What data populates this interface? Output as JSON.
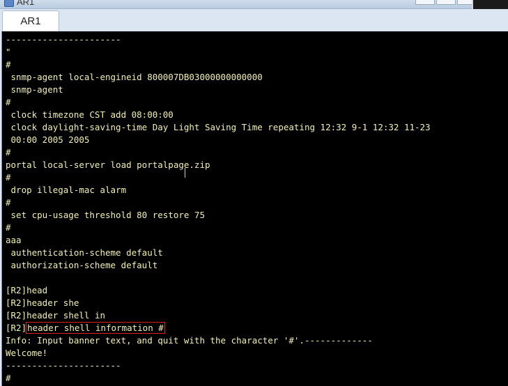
{
  "window": {
    "title": "AR1"
  },
  "tabs": [
    {
      "label": "AR1"
    }
  ],
  "terminal": {
    "lines": [
      {
        "text": "----------------------"
      },
      {
        "text": "\""
      },
      {
        "text": "#"
      },
      {
        "text": " snmp-agent local-engineid 800007DB03000000000000"
      },
      {
        "text": " snmp-agent"
      },
      {
        "text": "#"
      },
      {
        "text": " clock timezone CST add 08:00:00"
      },
      {
        "text": " clock daylight-saving-time Day Light Saving Time repeating 12:32 9-1 12:32 11-23"
      },
      {
        "text": " 00:00 2005 2005"
      },
      {
        "text": "#"
      },
      {
        "text": "portal local-server load portalpage.zip"
      },
      {
        "text": "#"
      },
      {
        "text": " drop illegal-mac alarm"
      },
      {
        "text": "#"
      },
      {
        "text": " set cpu-usage threshold 80 restore 75"
      },
      {
        "text": "#"
      },
      {
        "text": "aaa"
      },
      {
        "text": " authentication-scheme default"
      },
      {
        "text": " authorization-scheme default"
      },
      {
        "text": ""
      },
      {
        "prompt": "[R2]",
        "cmd": "head"
      },
      {
        "prompt": "[R2]",
        "cmd": "header she"
      },
      {
        "prompt": "[R2]",
        "cmd": "header shell in"
      },
      {
        "prompt": "[R2]",
        "cmd": "header shell information #",
        "highlighted": true
      },
      {
        "text": "Info: Input banner text, and quit with the character '#'.-------------"
      },
      {
        "text": "Welcome!"
      },
      {
        "text": "----------------------"
      },
      {
        "text": "#"
      }
    ]
  },
  "colors": {
    "terminal_bg": "#000000",
    "terminal_text": "#f3f0b2",
    "highlight_border": "#e02020"
  }
}
